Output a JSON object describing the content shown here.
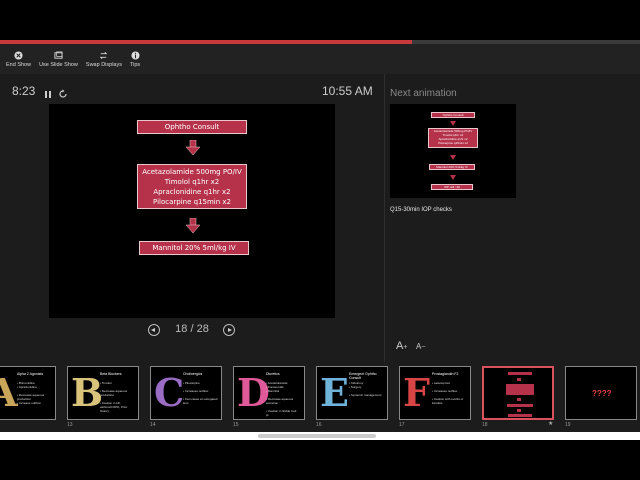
{
  "progress": 0.643,
  "colors": {
    "accent": "#c8393b",
    "slide_box": "#b5324a",
    "active_thumb": "#d9525e"
  },
  "toolbar": {
    "items": [
      {
        "label": "End Show",
        "icon": "close-circle-icon"
      },
      {
        "label": "Use Slide Show",
        "icon": "window-icon"
      },
      {
        "label": "Swap Displays",
        "icon": "swap-icon"
      },
      {
        "label": "Tips",
        "icon": "info-icon"
      }
    ]
  },
  "timer": "8:23",
  "clock": "10:55 AM",
  "current_slide": {
    "boxes": [
      "Ophtho Consult",
      "Acetazolamide 500mg PO/IV\nTimolol q1hr x2\nApraclonidine q1hr x2\nPilocarpine q15min x2",
      "Mannitol 20% 5ml/kg IV"
    ]
  },
  "counter": "18 / 28",
  "next": {
    "label": "Next animation",
    "boxes": [
      "Ophtho Consult",
      "Acetazolamide 500mg PO/IV\nTimolol q1hr x2\nApraclonidine q1hr x2\nPilocarpine q15min x2",
      "Mannitol 20% 5ml/kg IV",
      "IOP still >40"
    ]
  },
  "notes": "Q15-30min IOP checks",
  "font_controls": {
    "larger": "A",
    "smaller": "A"
  },
  "thumbnails": [
    {
      "number": "",
      "title": "Alpha 2 Agonists",
      "bullets": "• Brimonidine\n• Apraclonidine\n\n• Decrease aqueous\nproduction\n• Increase outflow",
      "art": "A",
      "art_color": "#c9a55a"
    },
    {
      "number": "13",
      "title": "Beta Blockers",
      "bullets": "• Timolol\n\n• Decrease aqueous\nproduction\n\n• Caution in HF,\nasthma/COPD, Prior\nhistory",
      "art": "B",
      "art_color": "#d9c27a"
    },
    {
      "number": "14",
      "title": "Cholinergics",
      "bullets": "• Pilocarpine\n\n• Increases outflow\n\n• Can cause an elongated\nlens",
      "art": "C",
      "art_color": "#9b6cc6"
    },
    {
      "number": "15",
      "title": "Diuretics",
      "bullets": "• Acetazolamide\n• Furosemide\n• Mannitol\n\n• Decrease aqueous\nsecretion\n\n• Caution in Sickle Cell\npt",
      "art": "D",
      "art_color": "#e05a9a"
    },
    {
      "number": "16",
      "title": "Emergent Ophtho Consult",
      "bullets": "• Iridotomy\n• Surgery\n\n• Systemic management",
      "art": "E",
      "art_color": "#6fb3d9"
    },
    {
      "number": "17",
      "title": "Prostaglandin F2",
      "bullets": "• Latanoprost\n\n• Increases outflow\n\n• Caution with uveitis or\nkeratitis",
      "art": "F",
      "art_color": "#d94545"
    },
    {
      "number": "18",
      "title": "",
      "bullets": "",
      "art": "",
      "art_color": ""
    },
    {
      "number": "19",
      "title": "????",
      "bullets": "",
      "art": "",
      "art_color": ""
    }
  ],
  "star_marker": "★"
}
